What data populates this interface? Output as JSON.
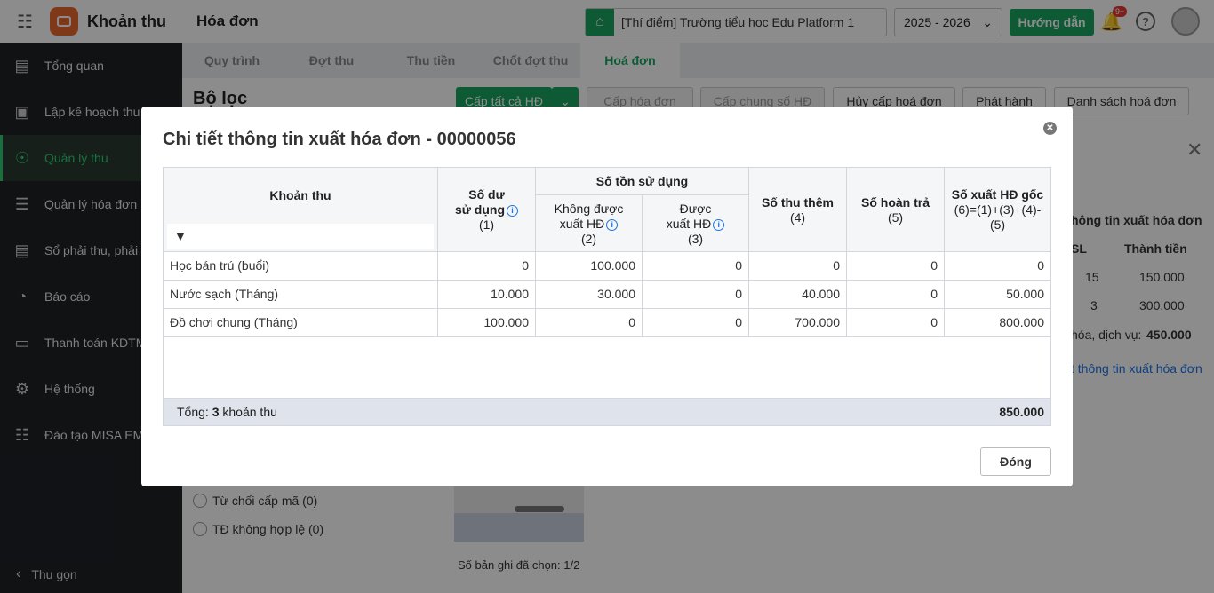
{
  "app": {
    "name": "Khoản thu",
    "page_title": "Hóa đơn"
  },
  "header": {
    "school": "[Thí điểm] Trường tiểu học Edu Platform 1",
    "year": "2025 - 2026",
    "guide_label": "Hướng dẫn",
    "notification_badge": "9+",
    "help_glyph": "?"
  },
  "sidebar": {
    "items": [
      {
        "label": "Tổng quan",
        "icon": "chart-icon"
      },
      {
        "label": "Lập kế hoạch thu",
        "icon": "plan-icon"
      },
      {
        "label": "Quản lý thu",
        "icon": "money-hand-icon",
        "active": true
      },
      {
        "label": "Quản lý hóa đơn",
        "icon": "invoice-icon"
      },
      {
        "label": "Sổ phải thu, phải trả",
        "icon": "ledger-icon"
      },
      {
        "label": "Báo cáo",
        "icon": "report-icon"
      },
      {
        "label": "Thanh toán KDTM",
        "icon": "card-icon"
      },
      {
        "label": "Hệ thống",
        "icon": "gear-icon"
      },
      {
        "label": "Đào tạo MISA EMIS",
        "icon": "book-icon"
      }
    ],
    "collapse_label": "Thu gọn"
  },
  "tabs": [
    "Quy trình",
    "Đợt thu",
    "Thu tiền",
    "Chốt đợt thu",
    "Hoá đơn"
  ],
  "background": {
    "filter_title": "Bộ lọc",
    "buttons": [
      "Cấp tất cả HĐ",
      "Cấp hóa đơn",
      "Cấp chung số HĐ",
      "Hủy cấp hoá đơn",
      "Phát hành",
      "Danh sách hoá đơn"
    ],
    "radios": [
      "Từ chối cấp mã (0)",
      "TĐ không hợp lệ (0)"
    ],
    "selected_count": "Số bản ghi đã chọn: 1/2",
    "side_table_header": "hông tin xuất hóa đơn",
    "side_sl": "SL",
    "side_thanh_tien": "Thành tiền",
    "side_rows": [
      [
        "15",
        "150.000"
      ],
      [
        "3",
        "300.000"
      ]
    ],
    "side_total_label": "hóa, dịch vụ:",
    "side_total_value": "450.000",
    "side_link": "t thông tin xuất hóa đơn"
  },
  "modal": {
    "title": "Chi tiết thông tin xuất hóa đơn - 00000056",
    "columns": {
      "khoan_thu": "Khoản thu",
      "so_du_1": "Số dư",
      "so_du_2": "sử dụng",
      "so_du_3": "(1)",
      "ton_group": "Số tồn sử dụng",
      "khong_1": "Không được",
      "khong_2": "xuất HĐ",
      "khong_3": "(2)",
      "duoc_1": "Được",
      "duoc_2": "xuất HĐ",
      "duoc_3": "(3)",
      "thu_them_1": "Số thu thêm",
      "thu_them_2": "(4)",
      "hoan_tra_1": "Số hoàn trả",
      "hoan_tra_2": "(5)",
      "goc_1": "Số xuất HĐ gốc",
      "goc_2": "(6)=(1)+(3)+(4)-",
      "goc_3": "(5)"
    },
    "rows": [
      {
        "name": "Học bán trú (buổi)",
        "c1": "0",
        "c2": "100.000",
        "c3": "0",
        "c4": "0",
        "c5": "0",
        "c6": "0"
      },
      {
        "name": "Nước sạch (Tháng)",
        "c1": "10.000",
        "c2": "30.000",
        "c3": "0",
        "c4": "40.000",
        "c5": "0",
        "c6": "50.000"
      },
      {
        "name": "Đồ chơi chung (Tháng)",
        "c1": "100.000",
        "c2": "0",
        "c3": "0",
        "c4": "700.000",
        "c5": "0",
        "c6": "800.000"
      }
    ],
    "footer_prefix": "Tổng:",
    "footer_count": "3",
    "footer_suffix": "khoản thu",
    "footer_total": "850.000",
    "close_label": "Đóng"
  }
}
